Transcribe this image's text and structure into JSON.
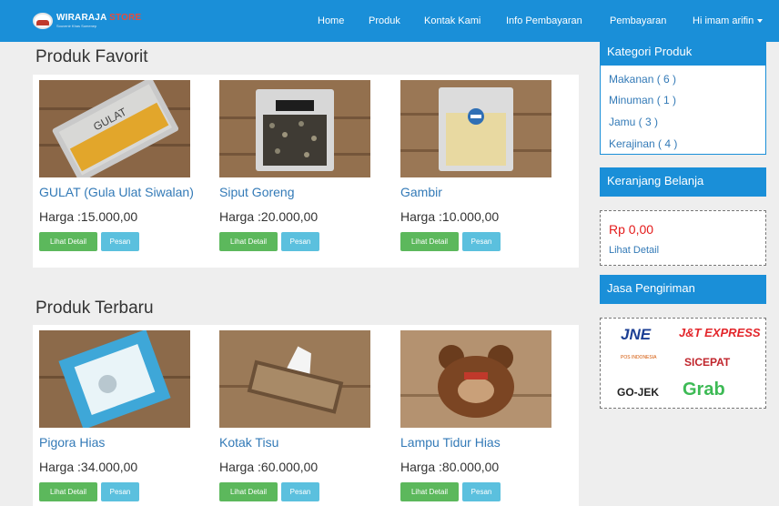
{
  "navbar": {
    "brand_name": "WIRARAJA",
    "brand_accent": "STORE",
    "brand_sub": "Souvenir Khas Sumenep",
    "links": [
      "Home",
      "Produk",
      "Kontak Kami",
      "Info Pembayaran",
      "Pembayaran"
    ],
    "user_menu": "Hi imam arifin"
  },
  "sections": {
    "favorit_title": "Produk Favorit",
    "terbaru_title": "Produk Terbaru"
  },
  "favorit": [
    {
      "name": "GULAT (Gula Ulat Siwalan)",
      "price": "Harga :15.000,00",
      "image": "gula-ulat-package"
    },
    {
      "name": "Siput Goreng",
      "price": "Harga :20.000,00",
      "image": "siput-goreng-package"
    },
    {
      "name": "Gambir",
      "price": "Harga :10.000,00",
      "image": "gambir-package"
    }
  ],
  "terbaru": [
    {
      "name": "Pigora Hias",
      "price": "Harga :34.000,00",
      "image": "pigora-frame"
    },
    {
      "name": "Kotak Tisu",
      "price": "Harga :60.000,00",
      "image": "tissue-box"
    },
    {
      "name": "Lampu Tidur Hias",
      "price": "Harga :80.000,00",
      "image": "bear-lamp"
    }
  ],
  "buttons": {
    "detail": "Lihat Detail",
    "pesan": "Pesan"
  },
  "sidebar": {
    "kategori_title": "Kategori Produk",
    "categories": [
      "Makanan ( 6 )",
      "Minuman ( 1 )",
      "Jamu ( 3 )",
      "Kerajinan ( 4 )"
    ],
    "cart_title": "Keranjang Belanja",
    "cart_total": "Rp 0,00",
    "cart_detail": "Lihat Detail",
    "shipping_title": "Jasa Pengiriman",
    "shipping": [
      "JNE",
      "J&T EXPRESS",
      "POS INDONESIA",
      "SICEPAT",
      "GO-JEK",
      "Grab"
    ]
  },
  "colors": {
    "nav": "#1a8fd8",
    "link": "#337ab7",
    "btn_detail": "#5cb85c",
    "btn_pesan": "#5bc0de",
    "cart_total": "#e41b1b"
  }
}
